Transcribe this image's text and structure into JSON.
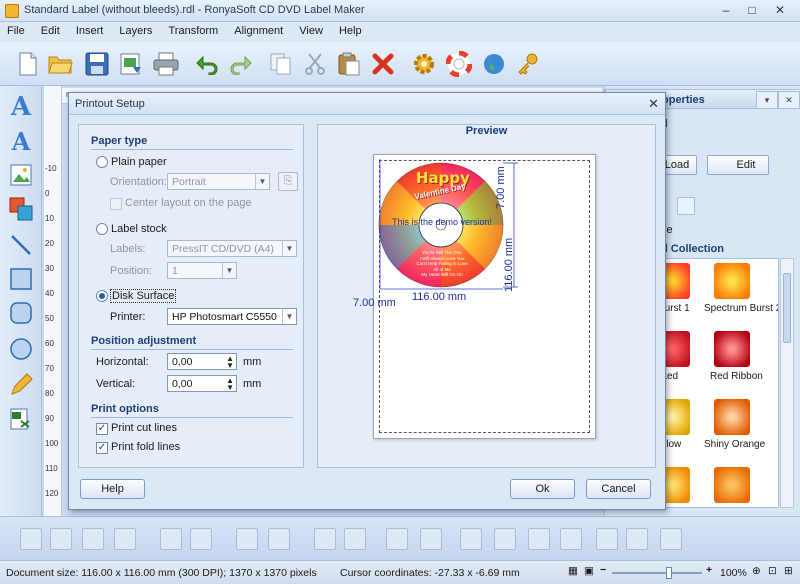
{
  "window": {
    "title": "Standard Label (without bleeds).rdl - RonyaSoft CD DVD Label Maker",
    "minimize": "–",
    "maximize": "□",
    "close": "✕"
  },
  "menu": [
    "File",
    "Edit",
    "Insert",
    "Layers",
    "Transform",
    "Alignment",
    "View",
    "Help"
  ],
  "toolbar": {
    "icons": [
      "new-icon",
      "open-icon",
      "save-icon",
      "export-icon",
      "print-icon",
      "undo-icon",
      "redo-icon",
      "copy-icon",
      "cut-icon",
      "paste-icon",
      "delete-icon",
      "settings-icon",
      "help-icon",
      "web-icon",
      "key-icon"
    ]
  },
  "ruler": {
    "vertical": [
      "-10",
      "0",
      "10",
      "20",
      "30",
      "40",
      "50",
      "60",
      "70",
      "80",
      "90",
      "100",
      "110",
      "120"
    ],
    "horizontal": [
      "mm"
    ]
  },
  "right_panel": {
    "header": "operties",
    "tab_label": "d",
    "load_button": "Load",
    "edit_button": "Edit",
    "fill_label": "se",
    "collection_title": "d Collection",
    "items": [
      {
        "label": "Burst 1",
        "color1": "#ff3a2a",
        "color2": "#ffd02a"
      },
      {
        "label": "Spectrum Burst 2",
        "color1": "#ff7a00",
        "color2": "#ffe14d"
      },
      {
        "label": "ked",
        "color1": "#c01020",
        "color2": "#ff6060"
      },
      {
        "label": "Red Ribbon",
        "color1": "#b50010",
        "color2": "#ff9090"
      },
      {
        "label": "llow",
        "color1": "#e4a400",
        "color2": "#fff0a0"
      },
      {
        "label": "Shiny Orange",
        "color1": "#e05a00",
        "color2": "#ffd0a0"
      },
      {
        "label": "",
        "color1": "#f08a00",
        "color2": "#ffe070"
      },
      {
        "label": "",
        "color1": "#e86a00",
        "color2": "#ffc060"
      }
    ]
  },
  "dialog": {
    "title": "Printout Setup",
    "close": "✕",
    "paper_type": {
      "heading": "Paper type",
      "plain_paper": "Plain paper",
      "orientation_label": "Orientation:",
      "orientation_value": "Portrait",
      "center_layout": "Center layout on the page",
      "label_stock": "Label stock",
      "labels_label": "Labels:",
      "labels_value": "PressIT CD/DVD (A4)",
      "position_label": "Position:",
      "position_value": "1",
      "disk_surface": "Disk Surface",
      "printer_label": "Printer:",
      "printer_value": "HP Photosmart C5550",
      "selected": "disk_surface"
    },
    "position_adjustment": {
      "heading": "Position adjustment",
      "horizontal_label": "Horizontal:",
      "horizontal_value": "0,00",
      "vertical_label": "Vertical:",
      "vertical_value": "0,00",
      "unit": "mm"
    },
    "print_options": {
      "heading": "Print options",
      "cut_lines": "Print cut lines",
      "fold_lines": "Print fold lines",
      "cut_checked": true,
      "fold_checked": true
    },
    "preview": {
      "title": "Preview",
      "dim_top": "7.00 mm",
      "dim_right": "116.00 mm",
      "dim_left": "7.00 mm",
      "dim_bottom": "116.00 mm",
      "disc_title": "Happy",
      "disc_subtitle": "Valentine Day",
      "demo_text": "This is the demo version!",
      "poem_lines": [
        "You're Still The One",
        "I Will Always Love You",
        "Can't Help Falling in Love",
        "All of Me",
        "My Heart Will Go On"
      ]
    },
    "buttons": {
      "help": "Help",
      "ok": "Ok",
      "cancel": "Cancel"
    }
  },
  "status": {
    "document_size": "Document size: 116.00 x 116.00 mm (300 DPI); 1370 x 1370 pixels",
    "cursor": "Cursor coordinates: -27.33 x -6.69 mm",
    "zoom": "100%",
    "zoom_level": 0.6
  }
}
